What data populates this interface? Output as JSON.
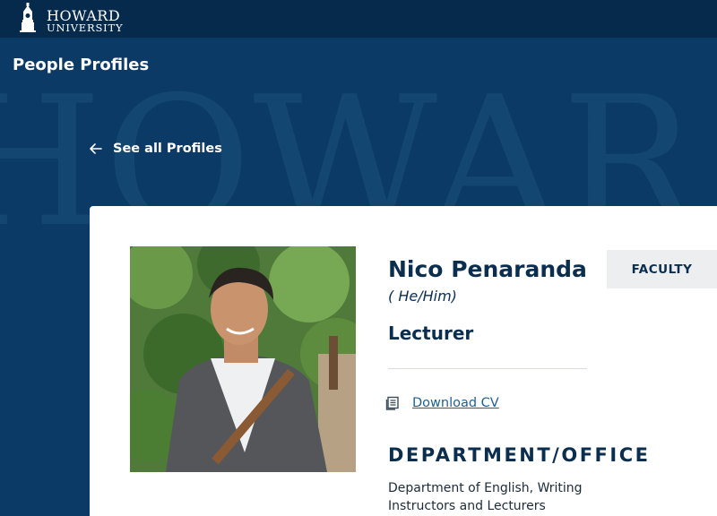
{
  "header": {
    "logo_line1": "HOWARD",
    "logo_line2": "UNIVERSITY",
    "logo_icon": "bell-tower-icon"
  },
  "hero": {
    "page_title": "People Profiles",
    "watermark_text": "HOWAR",
    "back_link": "See all Profiles",
    "back_icon": "arrow-left-icon"
  },
  "profile": {
    "name": "Nico Penaranda",
    "pronouns": "( He/Him)",
    "title": "Lecturer",
    "badge": "FACULTY",
    "cv_link": "Download CV",
    "cv_icon": "document-icon",
    "department_heading": "DEPARTMENT/OFFICE",
    "department": "Department of English, Writing Instructors and Lecturers"
  },
  "colors": {
    "header_bg": "#062a4c",
    "hero_bg": "#0b3a66",
    "heading_text": "#0b2e4f",
    "link": "#1f5f93",
    "badge_bg": "#eceeef"
  }
}
